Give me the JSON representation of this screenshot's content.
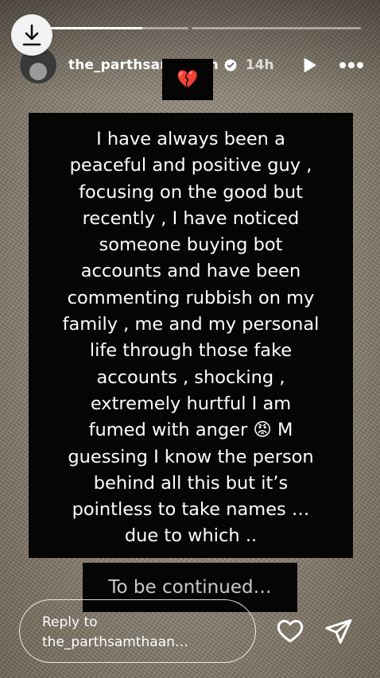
{
  "story": {
    "segments": [
      0.73,
      0.0
    ],
    "username": "the_parthsamthaan",
    "time": "14h"
  },
  "sticker": {
    "emoji": "💔"
  },
  "post_text_lines": [
    "I have always been a",
    "peaceful and positive guy ,",
    "focusing on the good but",
    "recently , I have noticed",
    "someone buying bot",
    "accounts and have been",
    "commenting rubbish on my",
    "family , me and my personal",
    "life through those fake",
    "accounts , shocking ,",
    "extremely hurtful I am",
    "fumed with anger 😡 M",
    "guessing I know the person",
    "behind all this but it’s",
    "pointless to take names …",
    "due to which .."
  ],
  "continued_text": "To be continued…",
  "reply": {
    "line1": "Reply to",
    "line2": "the_parthsamthaan…"
  },
  "icons": [
    "download-icon",
    "verified-icon",
    "play-icon",
    "more-icon",
    "heart-icon",
    "share-icon"
  ],
  "colors": {
    "card": "#050505",
    "text": "#ffffff",
    "verified": "#ffffff"
  }
}
